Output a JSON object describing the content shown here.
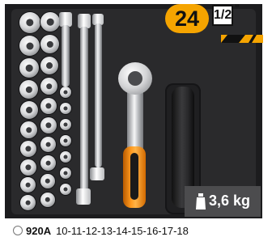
{
  "product": {
    "piece_count": "24",
    "drive_size": "1/2",
    "drive_symbol": "\"",
    "weight": "3,6 kg",
    "code": "920A",
    "sizes_text": "10-11-12-13-14-15-16-17-18"
  },
  "colors": {
    "accent": "#f5a400",
    "handle": "#ff9a1f",
    "badge_bg": "#4c4c4e",
    "tray": "#2a2a2c"
  },
  "icons": {
    "weight": "weight-icon",
    "caption": "socket-icon"
  }
}
